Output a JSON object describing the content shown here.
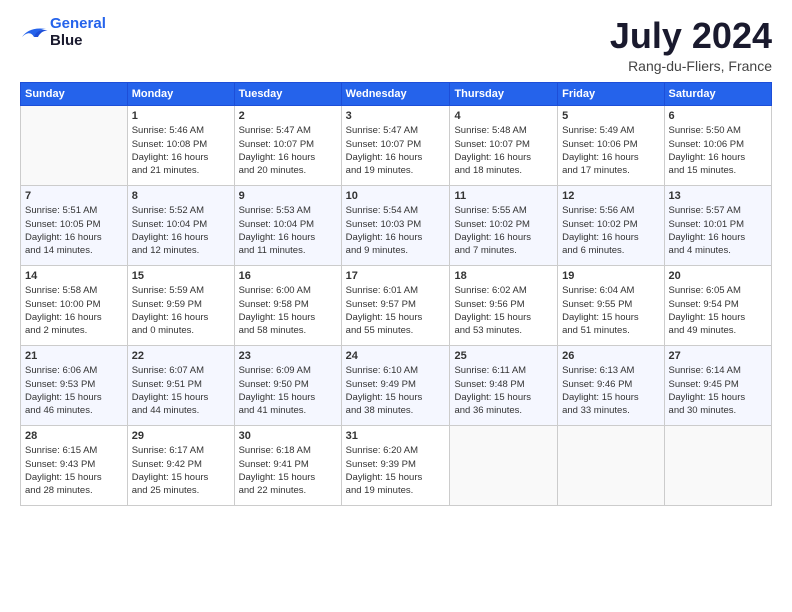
{
  "header": {
    "logo_line1": "General",
    "logo_line2": "Blue",
    "month_year": "July 2024",
    "location": "Rang-du-Fliers, France"
  },
  "columns": [
    "Sunday",
    "Monday",
    "Tuesday",
    "Wednesday",
    "Thursday",
    "Friday",
    "Saturday"
  ],
  "weeks": [
    [
      {
        "day": "",
        "info": ""
      },
      {
        "day": "1",
        "info": "Sunrise: 5:46 AM\nSunset: 10:08 PM\nDaylight: 16 hours\nand 21 minutes."
      },
      {
        "day": "2",
        "info": "Sunrise: 5:47 AM\nSunset: 10:07 PM\nDaylight: 16 hours\nand 20 minutes."
      },
      {
        "day": "3",
        "info": "Sunrise: 5:47 AM\nSunset: 10:07 PM\nDaylight: 16 hours\nand 19 minutes."
      },
      {
        "day": "4",
        "info": "Sunrise: 5:48 AM\nSunset: 10:07 PM\nDaylight: 16 hours\nand 18 minutes."
      },
      {
        "day": "5",
        "info": "Sunrise: 5:49 AM\nSunset: 10:06 PM\nDaylight: 16 hours\nand 17 minutes."
      },
      {
        "day": "6",
        "info": "Sunrise: 5:50 AM\nSunset: 10:06 PM\nDaylight: 16 hours\nand 15 minutes."
      }
    ],
    [
      {
        "day": "7",
        "info": "Sunrise: 5:51 AM\nSunset: 10:05 PM\nDaylight: 16 hours\nand 14 minutes."
      },
      {
        "day": "8",
        "info": "Sunrise: 5:52 AM\nSunset: 10:04 PM\nDaylight: 16 hours\nand 12 minutes."
      },
      {
        "day": "9",
        "info": "Sunrise: 5:53 AM\nSunset: 10:04 PM\nDaylight: 16 hours\nand 11 minutes."
      },
      {
        "day": "10",
        "info": "Sunrise: 5:54 AM\nSunset: 10:03 PM\nDaylight: 16 hours\nand 9 minutes."
      },
      {
        "day": "11",
        "info": "Sunrise: 5:55 AM\nSunset: 10:02 PM\nDaylight: 16 hours\nand 7 minutes."
      },
      {
        "day": "12",
        "info": "Sunrise: 5:56 AM\nSunset: 10:02 PM\nDaylight: 16 hours\nand 6 minutes."
      },
      {
        "day": "13",
        "info": "Sunrise: 5:57 AM\nSunset: 10:01 PM\nDaylight: 16 hours\nand 4 minutes."
      }
    ],
    [
      {
        "day": "14",
        "info": "Sunrise: 5:58 AM\nSunset: 10:00 PM\nDaylight: 16 hours\nand 2 minutes."
      },
      {
        "day": "15",
        "info": "Sunrise: 5:59 AM\nSunset: 9:59 PM\nDaylight: 16 hours\nand 0 minutes."
      },
      {
        "day": "16",
        "info": "Sunrise: 6:00 AM\nSunset: 9:58 PM\nDaylight: 15 hours\nand 58 minutes."
      },
      {
        "day": "17",
        "info": "Sunrise: 6:01 AM\nSunset: 9:57 PM\nDaylight: 15 hours\nand 55 minutes."
      },
      {
        "day": "18",
        "info": "Sunrise: 6:02 AM\nSunset: 9:56 PM\nDaylight: 15 hours\nand 53 minutes."
      },
      {
        "day": "19",
        "info": "Sunrise: 6:04 AM\nSunset: 9:55 PM\nDaylight: 15 hours\nand 51 minutes."
      },
      {
        "day": "20",
        "info": "Sunrise: 6:05 AM\nSunset: 9:54 PM\nDaylight: 15 hours\nand 49 minutes."
      }
    ],
    [
      {
        "day": "21",
        "info": "Sunrise: 6:06 AM\nSunset: 9:53 PM\nDaylight: 15 hours\nand 46 minutes."
      },
      {
        "day": "22",
        "info": "Sunrise: 6:07 AM\nSunset: 9:51 PM\nDaylight: 15 hours\nand 44 minutes."
      },
      {
        "day": "23",
        "info": "Sunrise: 6:09 AM\nSunset: 9:50 PM\nDaylight: 15 hours\nand 41 minutes."
      },
      {
        "day": "24",
        "info": "Sunrise: 6:10 AM\nSunset: 9:49 PM\nDaylight: 15 hours\nand 38 minutes."
      },
      {
        "day": "25",
        "info": "Sunrise: 6:11 AM\nSunset: 9:48 PM\nDaylight: 15 hours\nand 36 minutes."
      },
      {
        "day": "26",
        "info": "Sunrise: 6:13 AM\nSunset: 9:46 PM\nDaylight: 15 hours\nand 33 minutes."
      },
      {
        "day": "27",
        "info": "Sunrise: 6:14 AM\nSunset: 9:45 PM\nDaylight: 15 hours\nand 30 minutes."
      }
    ],
    [
      {
        "day": "28",
        "info": "Sunrise: 6:15 AM\nSunset: 9:43 PM\nDaylight: 15 hours\nand 28 minutes."
      },
      {
        "day": "29",
        "info": "Sunrise: 6:17 AM\nSunset: 9:42 PM\nDaylight: 15 hours\nand 25 minutes."
      },
      {
        "day": "30",
        "info": "Sunrise: 6:18 AM\nSunset: 9:41 PM\nDaylight: 15 hours\nand 22 minutes."
      },
      {
        "day": "31",
        "info": "Sunrise: 6:20 AM\nSunset: 9:39 PM\nDaylight: 15 hours\nand 19 minutes."
      },
      {
        "day": "",
        "info": ""
      },
      {
        "day": "",
        "info": ""
      },
      {
        "day": "",
        "info": ""
      }
    ]
  ]
}
